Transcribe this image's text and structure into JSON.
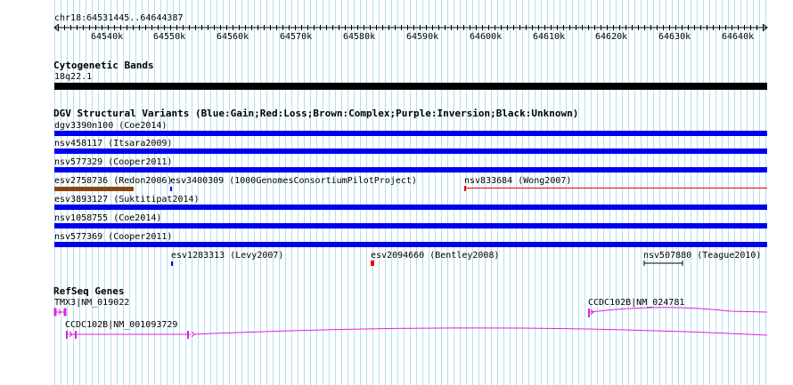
{
  "ruler": {
    "location": "chr18:64531445..64644387",
    "ticks": [
      "64540k",
      "64550k",
      "64560k",
      "64570k",
      "64580k",
      "64590k",
      "64600k",
      "64610k",
      "64620k",
      "64630k",
      "64640k"
    ]
  },
  "tracks": {
    "cytoband": {
      "title": "Cytogenetic Bands",
      "band": "18q22.1"
    },
    "dgv": {
      "title": "DGV Structural Variants (Blue:Gain;Red:Loss;Brown:Complex;Purple:Inversion;Black:Unknown)",
      "features": [
        "dgv3390n100 (Coe2014)",
        "nsv458117 (Itsara2009)",
        "nsv577329 (Cooper2011)",
        "esv2758736 (Redon2006)",
        "esv3400309 (1000GenomesConsortiumPilotProject)",
        "nsv833684 (Wong2007)",
        "esv3893127 (Suktitipat2014)",
        "nsv1058755 (Coe2014)",
        "nsv577369 (Cooper2011)",
        "esv1283313 (Levy2007)",
        "esv2094660 (Bentley2008)",
        "nsv507880 (Teague2010)"
      ]
    },
    "refseq": {
      "title": "RefSeq Genes",
      "genes": [
        "TMX3|NM_019022",
        "CCDC102B|NM_024781",
        "CCDC102B|NM_001093729"
      ]
    }
  },
  "colors": {
    "gain": "#0000ee",
    "loss": "#ee0000",
    "complex": "#8b4513",
    "unknown": "#000000",
    "gene": "#e020e0",
    "grid": "#b0e0f0"
  }
}
